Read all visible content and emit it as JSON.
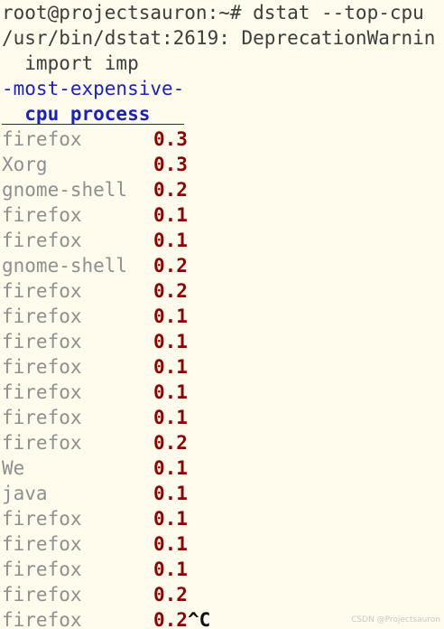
{
  "terminal": {
    "prompt_line": "root@projectsauron:~# dstat --top-cpu",
    "warning_line": "/usr/bin/dstat:2619: DeprecationWarnin",
    "import_line": "  import imp",
    "section_title": "-most-expensive-",
    "column_header": "  cpu process   ",
    "rows": [
      {
        "process": "firefox",
        "cpu": "0.3"
      },
      {
        "process": "Xorg",
        "cpu": "0.3"
      },
      {
        "process": "gnome-shell",
        "cpu": "0.2"
      },
      {
        "process": "firefox",
        "cpu": "0.1"
      },
      {
        "process": "firefox",
        "cpu": "0.1"
      },
      {
        "process": "gnome-shell",
        "cpu": "0.2"
      },
      {
        "process": "firefox",
        "cpu": "0.2"
      },
      {
        "process": "firefox",
        "cpu": "0.1"
      },
      {
        "process": "firefox",
        "cpu": "0.1"
      },
      {
        "process": "firefox",
        "cpu": "0.1"
      },
      {
        "process": "firefox",
        "cpu": "0.1"
      },
      {
        "process": "firefox",
        "cpu": "0.1"
      },
      {
        "process": "firefox",
        "cpu": "0.2"
      },
      {
        "process": "We",
        "cpu": "0.1"
      },
      {
        "process": "java",
        "cpu": "0.1"
      },
      {
        "process": "firefox",
        "cpu": "0.1"
      },
      {
        "process": "firefox",
        "cpu": "0.1"
      },
      {
        "process": "firefox",
        "cpu": "0.1"
      },
      {
        "process": "firefox",
        "cpu": "0.2"
      },
      {
        "process": "firefox",
        "cpu": "0.2"
      }
    ],
    "interrupt": "^C"
  },
  "watermark": "CSDN @Projectsauron",
  "colors": {
    "background": "#fffcee",
    "process_text": "#8f8f8f",
    "cpu_value": "#8b0000",
    "header_blue": "#1a22b8"
  }
}
